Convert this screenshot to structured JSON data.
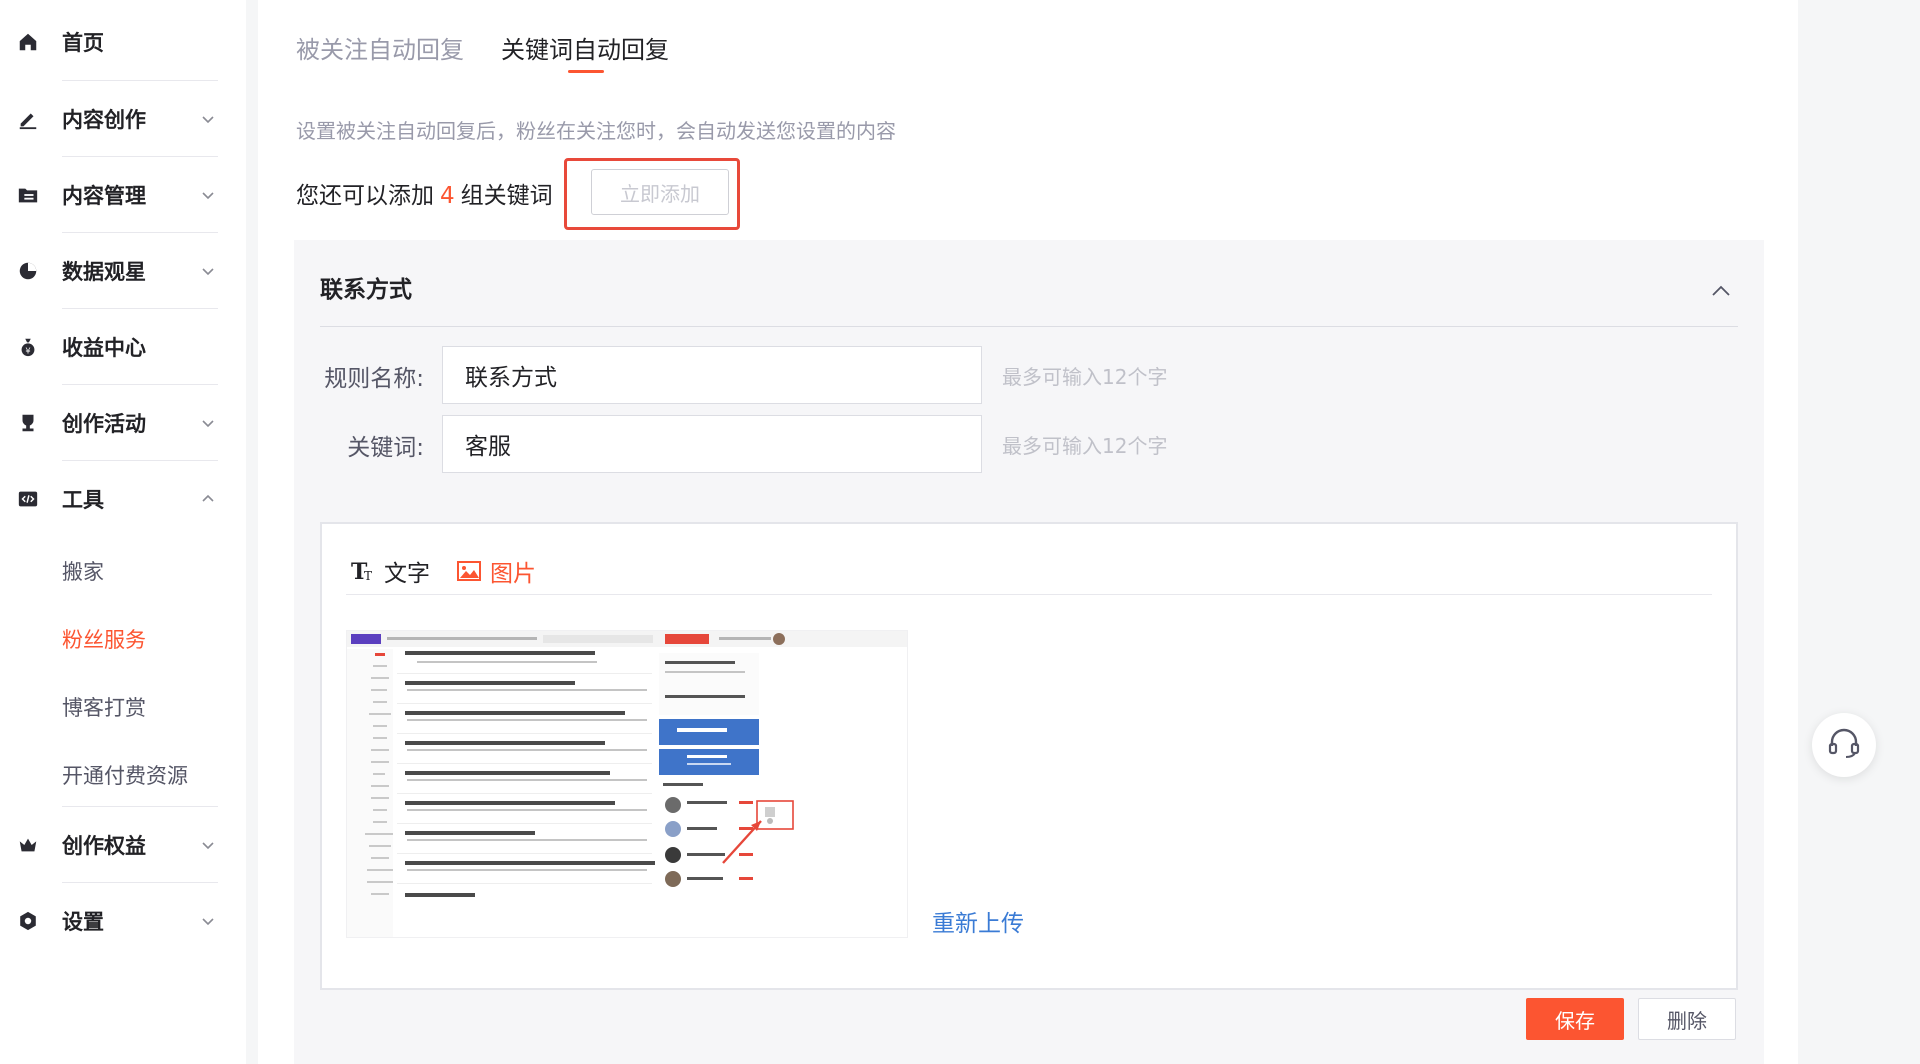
{
  "sidebar": {
    "items": [
      {
        "label": "首页",
        "icon": "home-icon"
      },
      {
        "label": "内容创作",
        "icon": "pencil-icon"
      },
      {
        "label": "内容管理",
        "icon": "folder-icon"
      },
      {
        "label": "数据观星",
        "icon": "pie-chart-icon"
      },
      {
        "label": "收益中心",
        "icon": "money-bag-icon"
      },
      {
        "label": "创作活动",
        "icon": "trophy-icon"
      },
      {
        "label": "工具",
        "icon": "code-icon"
      },
      {
        "label": "创作权益",
        "icon": "crown-icon"
      },
      {
        "label": "设置",
        "icon": "settings-icon"
      }
    ],
    "tools_sub": [
      {
        "label": "搬家",
        "active": false
      },
      {
        "label": "粉丝服务",
        "active": true
      },
      {
        "label": "博客打赏",
        "active": false
      },
      {
        "label": "开通付费资源",
        "active": false
      }
    ]
  },
  "main": {
    "tabs": [
      {
        "label": "被关注自动回复",
        "active": false
      },
      {
        "label": "关键词自动回复",
        "active": true
      }
    ],
    "description": "设置被关注自动回复后，粉丝在关注您时，会自动发送您设置的内容",
    "quota": {
      "prefix": "您还可以添加",
      "count": "4",
      "suffix": "组关键词"
    },
    "add_button": "立即添加"
  },
  "rule": {
    "title": "联系方式",
    "name_label": "规则名称:",
    "name_value": "联系方式",
    "name_hint": "最多可输入12个字",
    "keyword_label": "关键词:",
    "keyword_value": "客服",
    "keyword_hint": "最多可输入12个字",
    "editor": {
      "text_tab": "文字",
      "image_tab": "图片",
      "reupload": "重新上传"
    },
    "save_button": "保存",
    "delete_button": "删除"
  },
  "colors": {
    "accent": "#fc5531",
    "link": "#3a7bd5",
    "highlight": "#e8493a"
  }
}
